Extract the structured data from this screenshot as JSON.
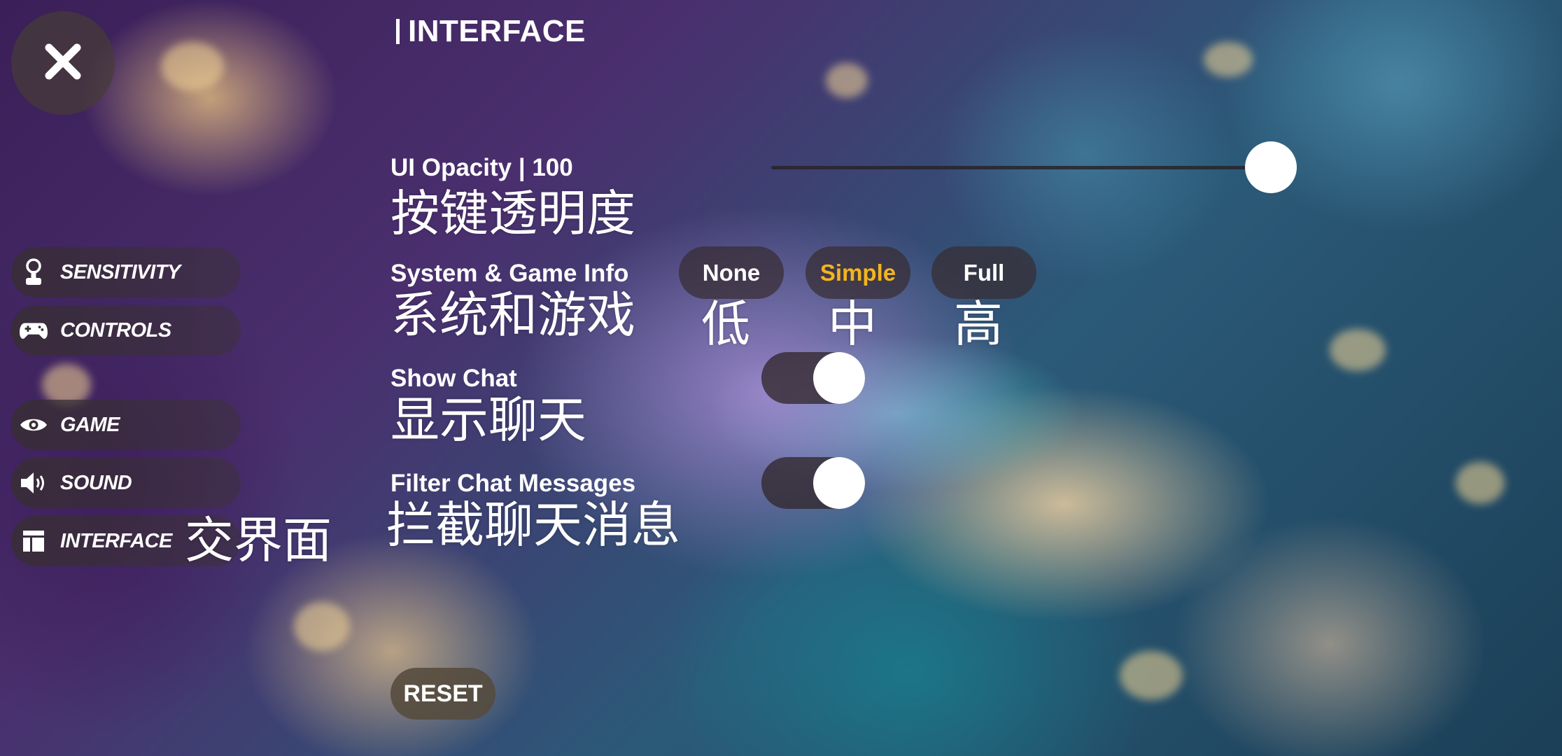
{
  "header": {
    "title": "INTERFACE"
  },
  "sidebar": {
    "items": [
      {
        "label": "SENSITIVITY",
        "icon": "joystick-icon"
      },
      {
        "label": "CONTROLS",
        "icon": "gamepad-icon"
      },
      {
        "label": "GAME",
        "icon": "eye-icon"
      },
      {
        "label": "SOUND",
        "icon": "speaker-icon"
      },
      {
        "label": "INTERFACE",
        "icon": "layout-icon",
        "active": true,
        "annotation": "交界面"
      }
    ]
  },
  "settings": {
    "ui_opacity": {
      "label": "UI Opacity | 100",
      "annotation": "按键透明度",
      "value": 100,
      "min": 0,
      "max": 100
    },
    "system_game_info": {
      "label": "System & Game Info",
      "annotation": "系统和游戏",
      "options": [
        {
          "label": "None",
          "annotation": "低"
        },
        {
          "label": "Simple",
          "annotation": "中"
        },
        {
          "label": "Full",
          "annotation": "高"
        }
      ],
      "selected": "Simple",
      "selected_color": "#f3b51c"
    },
    "show_chat": {
      "label": "Show Chat",
      "annotation": "显示聊天",
      "enabled": true
    },
    "filter_chat": {
      "label": "Filter Chat Messages",
      "annotation": "拦截聊天消息",
      "enabled": true
    }
  },
  "footer": {
    "reset_label": "RESET"
  }
}
